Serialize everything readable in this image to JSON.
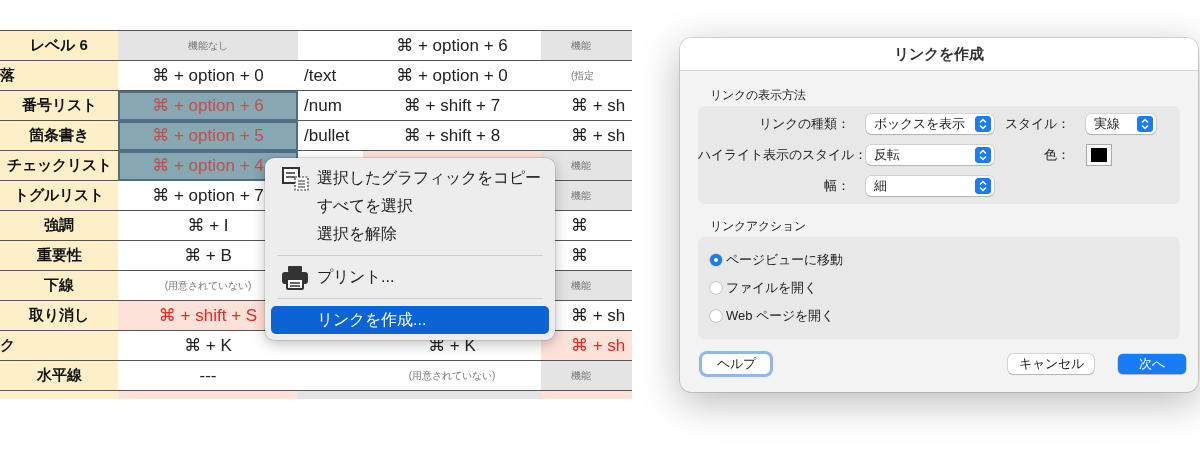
{
  "table": {
    "rows": [
      {
        "label": "レベル 6",
        "label_clipped": false,
        "cells": [
          {
            "kind": "off",
            "text": "機能なし",
            "selected": false
          },
          {
            "kind": "key",
            "selected": false
          },
          {
            "kind": "key",
            "text": "⌘ + option + 6",
            "selected": false
          },
          {
            "kind": "off",
            "text": "機能",
            "selected": false
          }
        ]
      },
      {
        "label": "落",
        "label_clipped": true,
        "cells": [
          {
            "kind": "key",
            "text": "⌘ + option + 0",
            "selected": false
          },
          {
            "kind": "cmd",
            "text": "/text",
            "selected": false
          },
          {
            "kind": "key",
            "text": "⌘ + option + 0",
            "selected": false
          },
          {
            "kind": "note",
            "text": "(指定",
            "selected": false
          }
        ]
      },
      {
        "label": "番号リスト",
        "label_clipped": false,
        "cells": [
          {
            "kind": "key",
            "text": "⌘ + option + 6",
            "selected": true
          },
          {
            "kind": "cmd",
            "text": "/num",
            "selected": false
          },
          {
            "kind": "key",
            "text": "⌘ + shift + 7",
            "selected": false
          },
          {
            "kind": "key",
            "text": "⌘ + sh",
            "selected": false
          }
        ]
      },
      {
        "label": "箇条書き",
        "label_clipped": false,
        "cells": [
          {
            "kind": "key",
            "text": "⌘ + option + 5",
            "selected": true
          },
          {
            "kind": "cmd",
            "text": "/bullet",
            "selected": false
          },
          {
            "kind": "key",
            "text": "⌘ + shift + 8",
            "selected": false
          },
          {
            "kind": "key",
            "text": "⌘ + sh",
            "selected": false
          }
        ]
      },
      {
        "label": "チェックリスト",
        "label_clipped": false,
        "cells": [
          {
            "kind": "key",
            "text": "⌘ + option + 4",
            "selected": true
          },
          {
            "kind": "key",
            "selected": false
          },
          {
            "kind": "warn",
            "selected": false
          },
          {
            "kind": "off",
            "text": "機能",
            "selected": false
          }
        ]
      },
      {
        "label": "トグルリスト",
        "label_clipped": false,
        "cells": [
          {
            "kind": "key",
            "text": "⌘ + option + 7",
            "selected": false
          },
          {
            "kind": "key"
          },
          {
            "kind": "key"
          },
          {
            "kind": "off",
            "text": "機能",
            "selected": false
          }
        ]
      },
      {
        "label": "強調",
        "label_clipped": false,
        "cells": [
          {
            "kind": "key",
            "text": "⌘ + I",
            "selected": false
          },
          {
            "kind": "key"
          },
          {
            "kind": "key"
          },
          {
            "kind": "key",
            "text": "⌘",
            "selected": false
          }
        ]
      },
      {
        "label": "重要性",
        "label_clipped": false,
        "cells": [
          {
            "kind": "key",
            "text": "⌘ + B",
            "selected": false
          },
          {
            "kind": "key"
          },
          {
            "kind": "key"
          },
          {
            "kind": "key",
            "text": "⌘",
            "selected": false
          }
        ]
      },
      {
        "label": "下線",
        "label_clipped": false,
        "cells": [
          {
            "kind": "note",
            "text": "(用意されていない)",
            "selected": false
          },
          {
            "kind": "key"
          },
          {
            "kind": "key"
          },
          {
            "kind": "off",
            "text": "機能",
            "selected": false
          }
        ]
      },
      {
        "label": "取り消し",
        "label_clipped": false,
        "cells": [
          {
            "kind": "warn",
            "text": "⌘ + shift + S",
            "selected": false
          },
          {
            "kind": "key"
          },
          {
            "kind": "key"
          },
          {
            "kind": "key",
            "text": "⌘ + sh",
            "selected": false
          }
        ]
      },
      {
        "label": "ク",
        "label_clipped": true,
        "cells": [
          {
            "kind": "key",
            "text": "⌘ + K",
            "selected": false
          },
          {
            "kind": "key",
            "selected": false
          },
          {
            "kind": "key",
            "text": "⌘ + K",
            "selected": false
          },
          {
            "kind": "warn",
            "text": "⌘ + sh",
            "selected": false
          }
        ]
      },
      {
        "label": "水平線",
        "label_clipped": false,
        "cells": [
          {
            "kind": "key",
            "text": "---",
            "selected": false
          },
          {
            "kind": "key",
            "selected": false
          },
          {
            "kind": "note",
            "text": "(用意されていない)",
            "selected": false
          },
          {
            "kind": "off",
            "text": "機能",
            "selected": false
          }
        ]
      }
    ]
  },
  "context_menu": {
    "items": [
      {
        "kind": "copy",
        "label": "選択したグラフィックをコピー",
        "selected": false
      },
      {
        "kind": "plain",
        "label": "すべてを選択",
        "selected": false
      },
      {
        "kind": "plain",
        "label": "選択を解除",
        "selected": false
      },
      {
        "kind": "separator"
      },
      {
        "kind": "print",
        "label": "プリント...",
        "selected": false
      },
      {
        "kind": "separator"
      },
      {
        "kind": "plain",
        "label": "リンクを作成...",
        "selected": true
      }
    ]
  },
  "dialog": {
    "title": "リンクを作成",
    "display_section": {
      "heading": "リンクの表示方法",
      "fields": [
        {
          "label": "リンクの種類：",
          "value": "ボックスを表示"
        },
        {
          "label": "ハイライト表示のスタイル：",
          "value": "反転"
        },
        {
          "label": "幅：",
          "value": "細"
        }
      ],
      "style": {
        "label": "スタイル：",
        "value": "実線"
      },
      "color": {
        "label": "色：",
        "color": "#000000"
      }
    },
    "action_section": {
      "heading": "リンクアクション",
      "options": [
        {
          "label": "ページビューに移動",
          "selected": true
        },
        {
          "label": "ファイルを開く",
          "selected": false
        },
        {
          "label": "Web ページを開く",
          "selected": false
        }
      ]
    },
    "buttons": [
      {
        "kind": "help",
        "label": "ヘルプ"
      },
      {
        "kind": "secondary",
        "label": "キャンセル"
      },
      {
        "kind": "primary",
        "label": "次へ"
      }
    ]
  }
}
